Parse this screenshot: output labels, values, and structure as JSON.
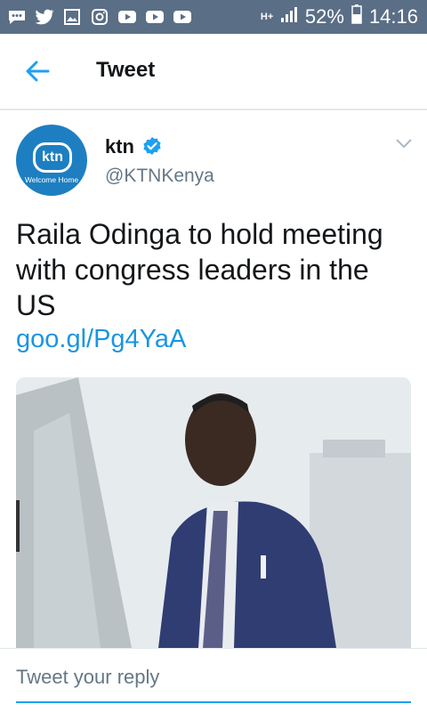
{
  "status_bar": {
    "battery": "52%",
    "time": "14:16",
    "network": "H+",
    "left_icons": [
      "messages-icon",
      "twitter-icon",
      "gallery-icon",
      "instagram-icon",
      "youtube-icon",
      "youtube-icon",
      "youtube-icon"
    ]
  },
  "app_bar": {
    "title": "Tweet"
  },
  "tweet": {
    "author_name": "ktn",
    "handle": "@KTNKenya",
    "avatar": {
      "logo_text": "ktn",
      "tagline": "Welcome Home"
    },
    "text": "Raila Odinga to hold meeting with congress leaders in the US",
    "link": "goo.gl/Pg4YaA"
  },
  "reply": {
    "placeholder": "Tweet your reply"
  },
  "colors": {
    "status_bar": "#5a6e86",
    "accent": "#1da1f2",
    "link": "#1b95e0",
    "avatar": "#1d7fc1"
  }
}
